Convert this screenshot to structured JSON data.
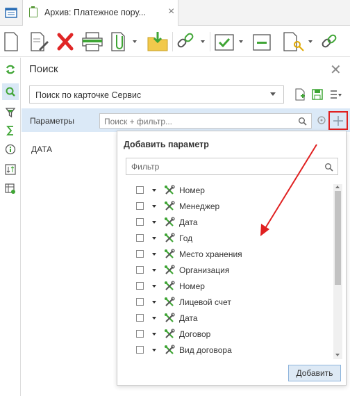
{
  "tab": {
    "title": "Архив: Платежное пору...",
    "close": "×"
  },
  "panel": {
    "title": "Поиск",
    "close": "✕",
    "search_mode": "Поиск по карточке Сервис",
    "params_label": "Параметры",
    "param_search_placeholder": "Поиск + фильтр...",
    "data_label": "ДАТА"
  },
  "popup": {
    "title": "Добавить параметр",
    "filter_placeholder": "Фильтр",
    "items": [
      {
        "label": "Номер"
      },
      {
        "label": "Менеджер"
      },
      {
        "label": "Дата"
      },
      {
        "label": "Год"
      },
      {
        "label": "Место хранения"
      },
      {
        "label": "Организация"
      },
      {
        "label": "Номер"
      },
      {
        "label": "Лицевой счет"
      },
      {
        "label": "Дата"
      },
      {
        "label": "Договор"
      },
      {
        "label": "Вид договора"
      }
    ],
    "add_button": "Добавить"
  },
  "colors": {
    "accent_green": "#3fa535",
    "highlight_red": "#e02020",
    "params_bar": "#dbe9f7"
  }
}
